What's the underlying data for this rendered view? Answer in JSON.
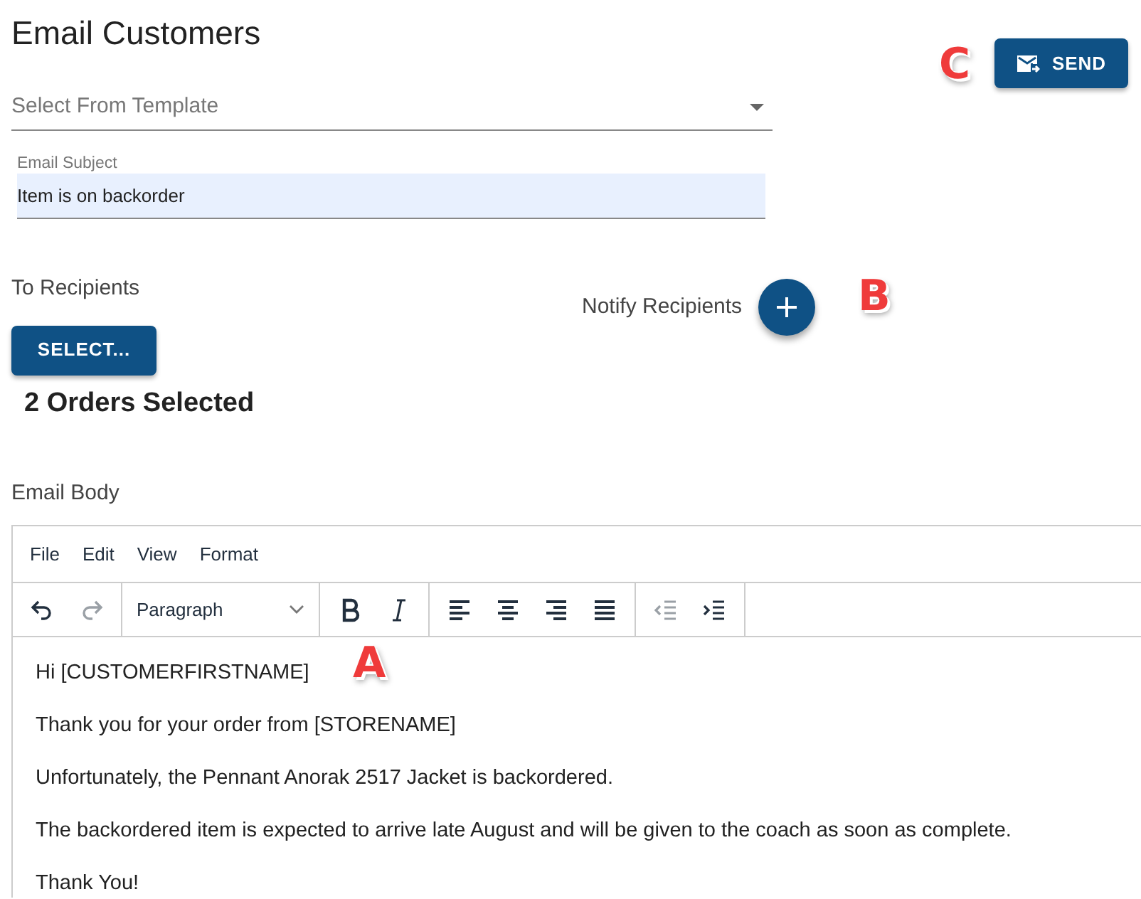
{
  "title": "Email Customers",
  "send_button": {
    "label": "SEND"
  },
  "template_select": {
    "placeholder": "Select From Template"
  },
  "subject_field": {
    "label": "Email Subject",
    "value": "Item is on backorder"
  },
  "recipients": {
    "label": "To Recipients",
    "select_button": "SELECT...",
    "summary": "2 Orders Selected"
  },
  "notify": {
    "label": "Notify Recipients"
  },
  "body_label": "Email Body",
  "editor": {
    "menu": [
      "File",
      "Edit",
      "View",
      "Format"
    ],
    "toolbar": [
      {
        "kind": "undo",
        "disabled": false
      },
      {
        "kind": "redo",
        "disabled": true
      },
      {
        "kind": "block",
        "label": "Paragraph"
      },
      {
        "kind": "bold",
        "disabled": false
      },
      {
        "kind": "italic",
        "disabled": false
      },
      {
        "kind": "align-left",
        "disabled": false
      },
      {
        "kind": "align-center",
        "disabled": false
      },
      {
        "kind": "align-right",
        "disabled": false
      },
      {
        "kind": "justify",
        "disabled": false
      },
      {
        "kind": "outdent",
        "disabled": true
      },
      {
        "kind": "indent",
        "disabled": false
      }
    ],
    "paragraphs": [
      "Hi [CUSTOMERFIRSTNAME]",
      "Thank you for your order from [STORENAME]",
      "Unfortunately, the Pennant Anorak 2517 Jacket is backordered.",
      "The backordered item is expected to arrive late August and will be given to the coach as soon as complete.",
      "Thank You!"
    ]
  },
  "callouts": [
    {
      "text": "A"
    },
    {
      "text": "B"
    },
    {
      "text": "C"
    }
  ]
}
